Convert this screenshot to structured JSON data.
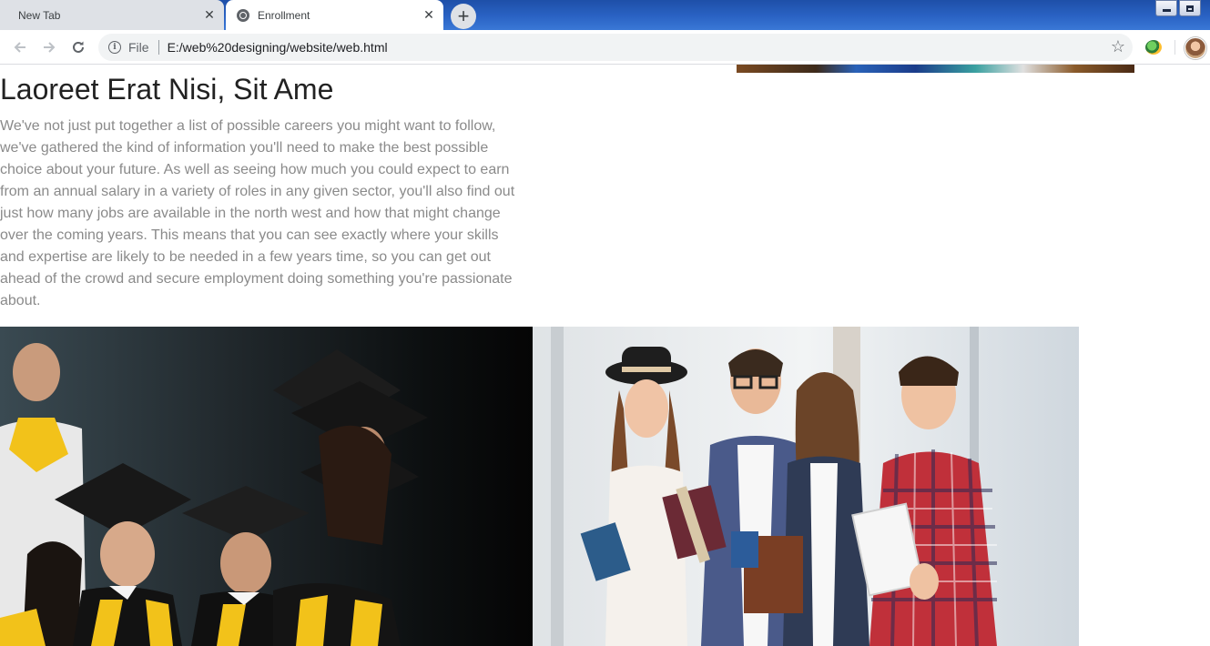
{
  "browser": {
    "tabs": [
      {
        "title": "New Tab",
        "active": false
      },
      {
        "title": "Enrollment",
        "active": true
      }
    ],
    "close_glyph": "✕",
    "new_tab_glyph": "+",
    "address": {
      "scheme_label": "File",
      "url": "E:/web%20designing/website/web.html"
    },
    "icons": {
      "back": "back-arrow-icon",
      "forward": "forward-arrow-icon",
      "reload": "reload-icon",
      "info": "info-icon",
      "bookmark": "star-icon"
    }
  },
  "page": {
    "heading": "Laoreet Erat Nisi, Sit Ame",
    "paragraph": "We've not just put together a list of possible careers you might want to follow, we've gathered the kind of information you'll need to make the best possible choice about your future. As well as seeing how much you could expect to earn from an annual salary in a variety of roles in any given sector, you'll also find out just how many jobs are available in the north west and how that might change over the coming years. This means that you can see exactly where your skills and expertise are likely to be needed in a few years time, so you can get out ahead of the crowd and secure employment doing something you're passionate about."
  },
  "colors": {
    "heading": "#222222",
    "paragraph": "#8a8a8a",
    "tabstrip": "#2a63c4",
    "gown_stripe": "#f2c21a"
  }
}
